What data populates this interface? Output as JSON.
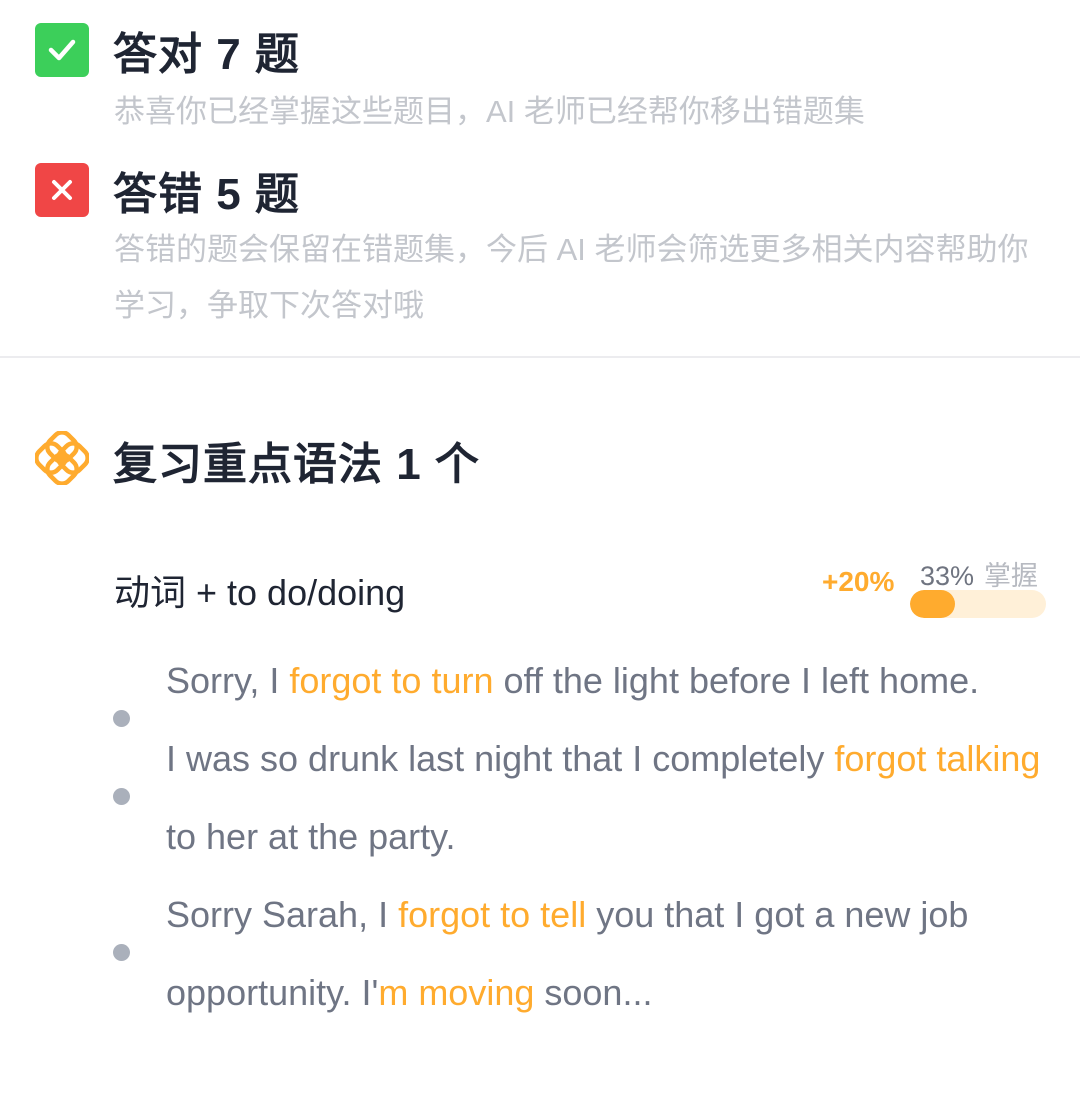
{
  "correct": {
    "title": "答对 7 题",
    "desc": "恭喜你已经掌握这些题目，AI 老师已经帮你移出错题集"
  },
  "wrong": {
    "title": "答错 5 题",
    "desc": "答错的题会保留在错题集，今后 AI 老师会筛选更多相关内容帮助你学习，争取下次答对哦"
  },
  "grammar_section": {
    "title": "复习重点语法 1 个",
    "item": {
      "name": "动词 + to do/doing",
      "gain": "+20%",
      "mastery_pct": "33%",
      "mastery_word": "掌握",
      "mastery_value": 0.33
    }
  },
  "examples": [
    [
      {
        "text": "Sorry, I ",
        "hl": false
      },
      {
        "text": "forgot to turn",
        "hl": true
      },
      {
        "text": " off the light before I left home.",
        "hl": false
      }
    ],
    [
      {
        "text": "I was so drunk last night that I completely ",
        "hl": false
      },
      {
        "text": "forgot talking",
        "hl": true
      },
      {
        "text": " to her at the party.",
        "hl": false
      }
    ],
    [
      {
        "text": "Sorry Sarah, I ",
        "hl": false
      },
      {
        "text": "forgot to tell",
        "hl": true
      },
      {
        "text": " you that I got a new job opportunity. I'",
        "hl": false
      },
      {
        "text": "m moving",
        "hl": true
      },
      {
        "text": " soon...",
        "hl": false
      }
    ]
  ],
  "colors": {
    "accent": "#ffab2e",
    "correct": "#3ccf5a",
    "wrong": "#f04646"
  },
  "icons": {
    "correct": "check-icon",
    "wrong": "close-icon",
    "section": "grammar-knot-icon"
  }
}
